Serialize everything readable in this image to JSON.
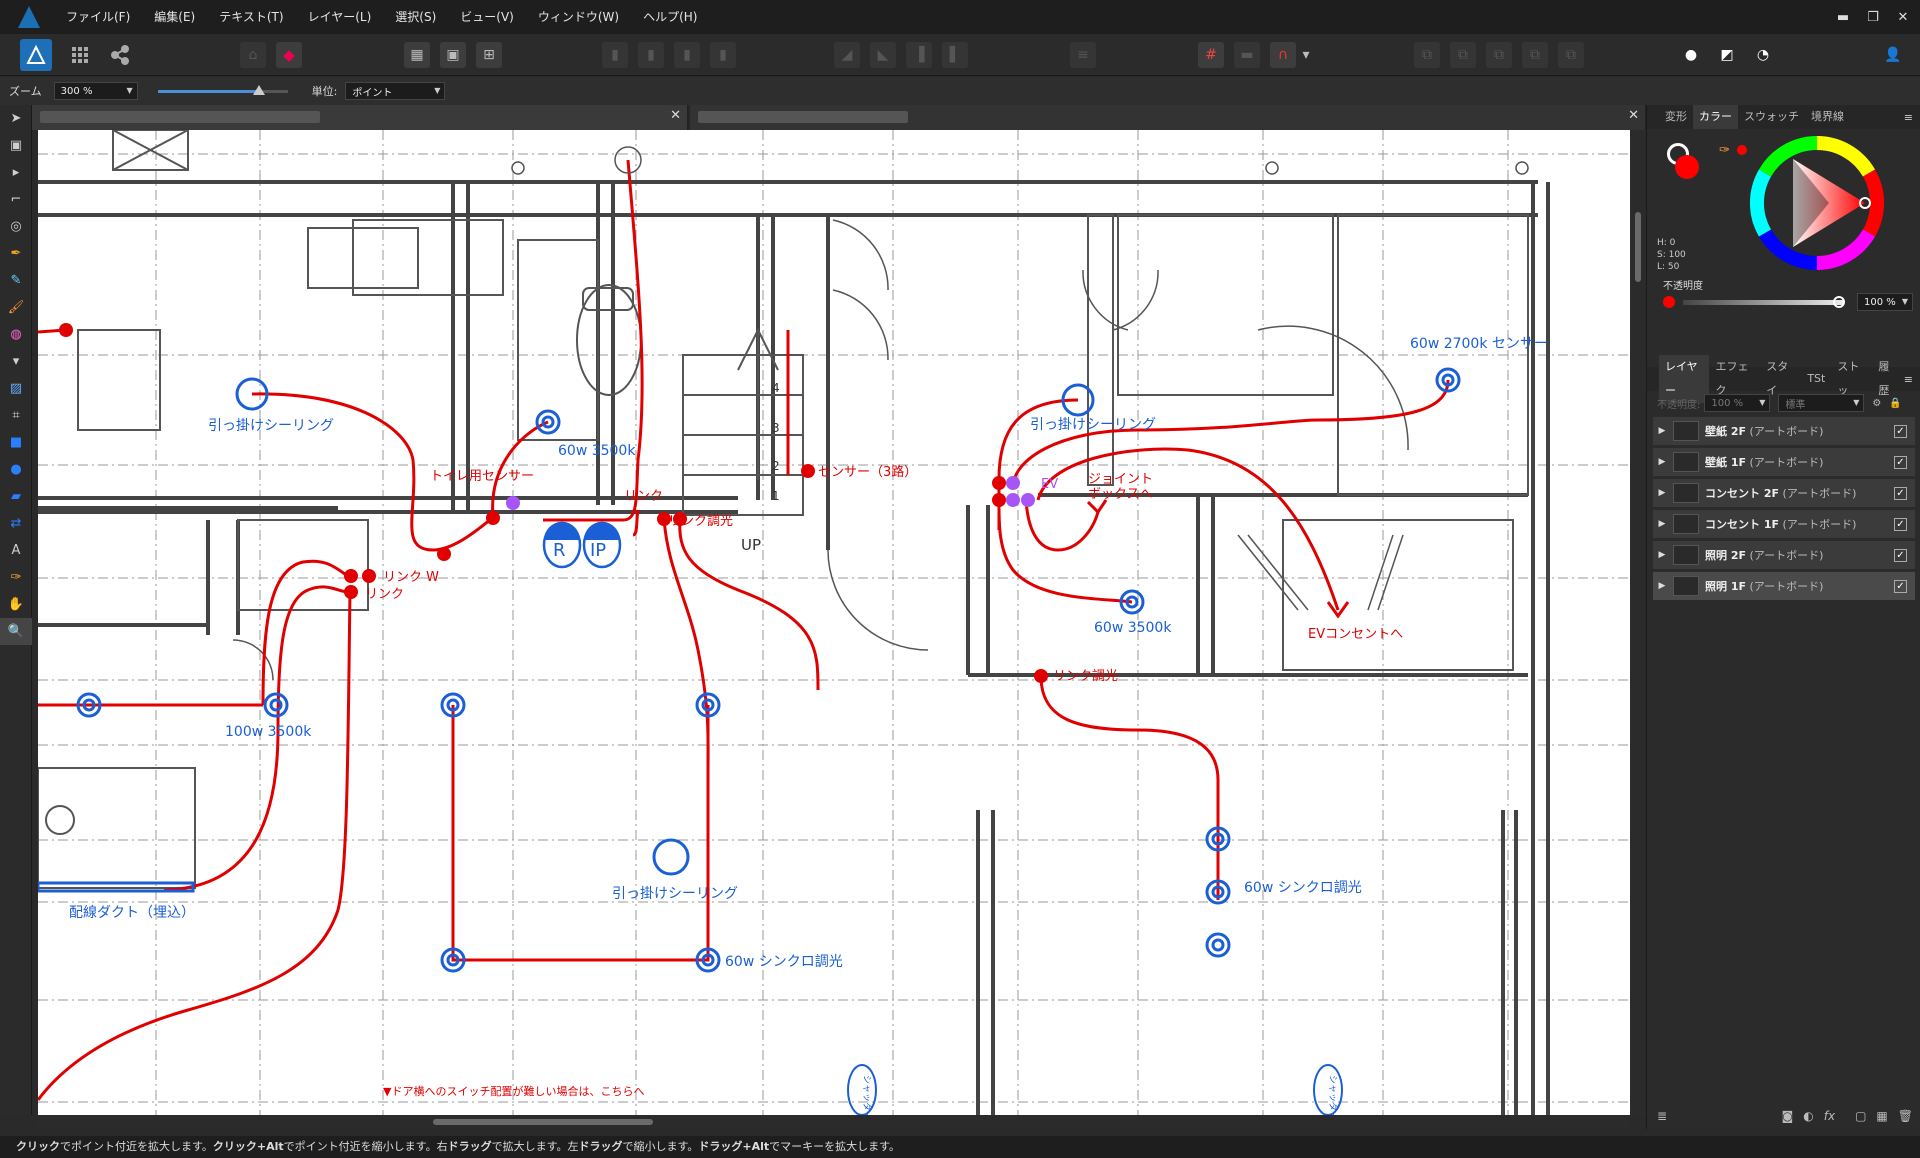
{
  "menubar": {
    "items": [
      "ファイル(F)",
      "編集(E)",
      "テキスト(T)",
      "レイヤー(L)",
      "選択(S)",
      "ビュー(V)",
      "ウィンドウ(W)",
      "ヘルプ(H)"
    ],
    "window_controls": [
      "minimize-icon",
      "restore-icon",
      "close-icon"
    ]
  },
  "context": {
    "zoom_label": "ズーム",
    "zoom_value": "300 %",
    "zoom_slider_level": 0.78,
    "unit_label": "単位:",
    "unit_value": "ポイント"
  },
  "tools": [
    "move-tool-icon",
    "artboard-tool-icon",
    "node-tool-icon",
    "corner-tool-icon",
    "point-transform-icon",
    "pen-tool-icon",
    "pencil-tool-icon",
    "vector-brush-icon",
    "fill-tool-icon",
    "transparency-tool-icon",
    "place-image-icon",
    "crop-tool-icon",
    "rectangle-tool-icon",
    "ellipse-tool-icon",
    "rounded-rect-icon",
    "vector-crop-icon",
    "text-tool-icon",
    "eyedropper-icon",
    "hand-tool-icon",
    "zoom-tool-icon"
  ],
  "right_panel": {
    "top_tabs": [
      "変形",
      "カラー",
      "スウォッチ",
      "境界線"
    ],
    "active_top_tab": "カラー",
    "color": {
      "h": "H: 0",
      "s": "S: 100",
      "l": "L: 50",
      "opacity_label": "不透明度",
      "opacity_value": "100 %",
      "current": "#ff0000"
    },
    "layer_tabs": [
      "レイヤー",
      "エフェク",
      "スタイ",
      "TSt",
      "ストッ",
      "履歴"
    ],
    "layer_opacity_label": "不透明度:",
    "layer_opacity_value": "100 %",
    "blend_mode": "標準",
    "layers": [
      {
        "name": "壁紙 2F",
        "type": "(アートボード)",
        "visible": "✓"
      },
      {
        "name": "壁紙 1F",
        "type": "(アートボード)",
        "visible": "✓"
      },
      {
        "name": "コンセント 2F",
        "type": "(アートボード)",
        "visible": "✓"
      },
      {
        "name": "コンセント 1F",
        "type": "(アートボード)",
        "visible": "✓"
      },
      {
        "name": "照明 2F",
        "type": "(アートボード)",
        "visible": "✓"
      },
      {
        "name": "照明 1F",
        "type": "(アートボード)",
        "visible": "✓"
      }
    ]
  },
  "plan": {
    "labels": {
      "ceiling_left": "引っ掛けシーリング",
      "toilet_light": "60w 3500k",
      "toilet_sensor": "トイレ用センサー",
      "link1": "リンク",
      "link_dim": "リンク調光",
      "sensor_3way": "センサー（3路）",
      "ceiling_right": "引っ掛けシーリング",
      "light_2700": "60w 2700k センサー",
      "ev_tag": "EV",
      "junction": "ジョイント\nボックスへ",
      "light_3500_mid": "60w 3500k",
      "ev_outlet": "EVコンセントへ",
      "link_w": "リンク W",
      "link2": "リンク",
      "light_100w": "100w 3500k",
      "link_dim2": "リンク調光",
      "duct": "配線ダクト（埋込）",
      "ceiling_center": "引っ掛けシーリング",
      "synchro1": "60w シンクロ調光",
      "synchro2": "60w シンクロ調光",
      "up": "UP",
      "r": "R",
      "ip": "IP",
      "door_note": "▼ドア横へのスイッチ配置が難しい場合は、こちらへ",
      "stairs": [
        "1",
        "2",
        "3",
        "4"
      ],
      "shutter": "シャッター"
    }
  },
  "status": {
    "segments": [
      {
        "b": "クリック",
        "t": "でポイント付近を拡大します。"
      },
      {
        "b": "クリック+Alt",
        "t": "でポイント付近を縮小します。右"
      },
      {
        "b": "ドラッグ",
        "t": "で拡大します。左"
      },
      {
        "b": "ドラッグ",
        "t": "で縮小します。"
      },
      {
        "b": "ドラッグ+Alt",
        "t": "でマーキーを拡大します。"
      }
    ]
  }
}
